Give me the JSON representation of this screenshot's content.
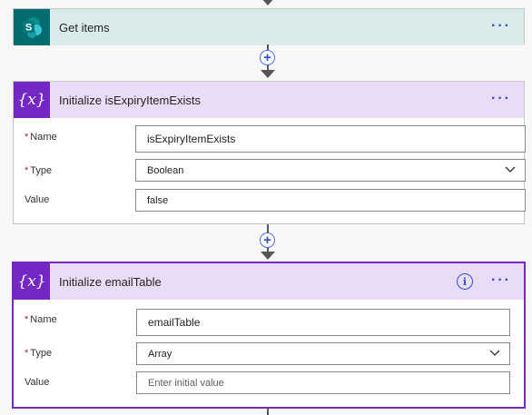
{
  "colors": {
    "sharepoint_header_bg": "#d9ebeb",
    "sharepoint_icon_bg": "#036c70",
    "variable_header_bg": "#eadcf6",
    "variable_icon_bg": "#7527c6",
    "accent_blue": "#2f4fcf"
  },
  "steps": [
    {
      "title": "Get items",
      "icon": "sharepoint-icon",
      "more_label": "···"
    },
    {
      "title": "Initialize isExpiryItemExists",
      "icon": "variable-icon",
      "more_label": "···",
      "fields": {
        "name_label": "Name",
        "name_value": "isExpiryItemExists",
        "type_label": "Type",
        "type_value": "Boolean",
        "value_label": "Value",
        "value_value": "false"
      }
    },
    {
      "title": "Initialize emailTable",
      "icon": "variable-icon",
      "more_label": "···",
      "info_label": "i",
      "fields": {
        "name_label": "Name",
        "name_value": "emailTable",
        "type_label": "Type",
        "type_value": "Array",
        "value_label": "Value",
        "value_placeholder": "Enter initial value"
      }
    }
  ],
  "connectors": {
    "plus_label": "+"
  },
  "required_marker": "*",
  "variable_icon_text": "{x}",
  "sharepoint_icon_text": "S"
}
